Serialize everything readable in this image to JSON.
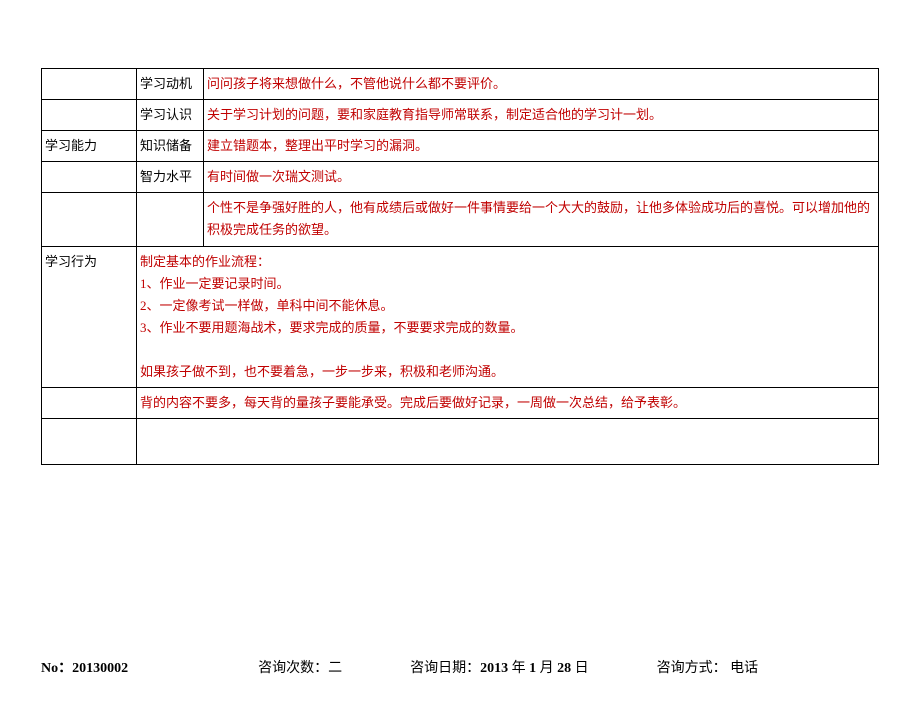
{
  "table": {
    "rows": [
      {
        "col1": "",
        "col2": "学习动机",
        "col3": "问问孩子将来想做什么，不管他说什么都不要评价。"
      },
      {
        "col1": "",
        "col2": "学习认识",
        "col3": "关于学习计划的问题，要和家庭教育指导师常联系，制定适合他的学习计一划。"
      },
      {
        "col1": "学习能力",
        "col2": "知识储备",
        "col3": "建立错题本，整理出平时学习的漏洞。"
      },
      {
        "col1": "",
        "col2": "智力水平",
        "col3": "有时间做一次瑞文测试。"
      },
      {
        "col1": "",
        "col2": "",
        "col3": "个性不是争强好胜的人，他有成绩后或做好一件事情要给一个大大的鼓励，让他多体验成功后的喜悦。可以增加他的积极完成任务的欲望。"
      },
      {
        "col1": "学习行为",
        "col2_merged": true,
        "lines": [
          "制定基本的作业流程：",
          "1、作业一定要记录时间。",
          "2、一定像考试一样做，单科中间不能休息。",
          "3、作业不要用题海战术，要求完成的质量，不要要求完成的数量。",
          "",
          "如果孩子做不到，也不要着急，一步一步来，积极和老师沟通。"
        ]
      },
      {
        "col1": "",
        "col2_merged": true,
        "col3": "背的内容不要多，每天背的量孩子要能承受。完成后要做好记录，一周做一次总结，给予表彰。"
      }
    ]
  },
  "footer": {
    "no_label": "No：",
    "no_value": "20130002",
    "count_label": "咨询次数：",
    "count_value": "二",
    "date_label": "咨询日期：",
    "date_year": "2013",
    "date_year_unit": " 年 ",
    "date_month": "1",
    "date_month_unit": " 月 ",
    "date_day": "28",
    "date_day_unit": " 日",
    "method_label": "咨询方式：",
    "method_value": "   电话"
  }
}
